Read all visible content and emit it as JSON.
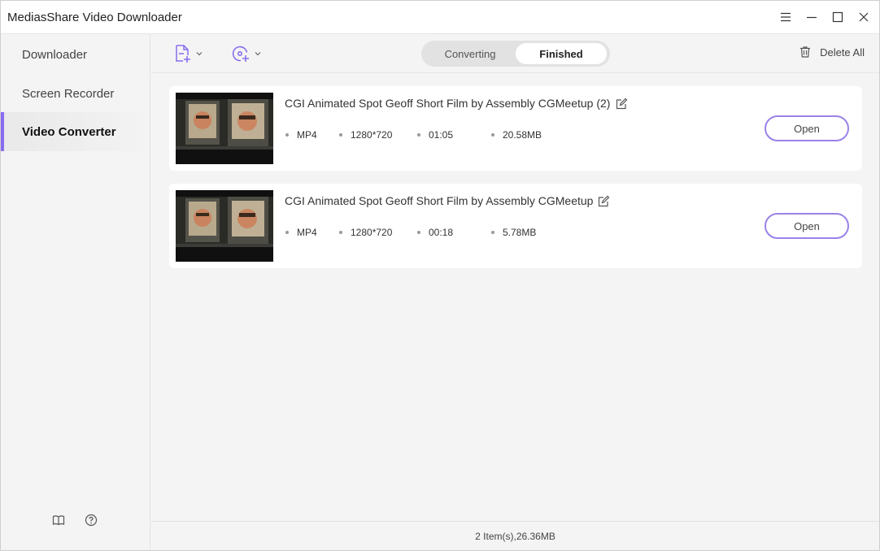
{
  "window": {
    "title": "MediasShare Video Downloader",
    "controls": [
      "menu-icon",
      "minimize-icon",
      "maximize-icon",
      "close-icon"
    ]
  },
  "sidebar": {
    "items": [
      {
        "label": "Downloader",
        "active": false
      },
      {
        "label": "Screen Recorder",
        "active": false
      },
      {
        "label": "Video Converter",
        "active": true
      }
    ],
    "bottom_icons": [
      "book-icon",
      "help-icon"
    ]
  },
  "toolbar": {
    "add_file_icon": "add-file-icon",
    "add_disc_icon": "add-disc-icon",
    "tabs": [
      {
        "label": "Converting",
        "active": false
      },
      {
        "label": "Finished",
        "active": true
      }
    ],
    "delete_all_label": "Delete All"
  },
  "items": [
    {
      "title": "CGI Animated Spot Geoff Short Film by Assembly  CGMeetup (2)",
      "format": "MP4",
      "resolution": "1280*720",
      "duration": "01:05",
      "size": "20.58MB",
      "open_label": "Open"
    },
    {
      "title": "CGI Animated Spot Geoff Short Film by Assembly  CGMeetup",
      "format": "MP4",
      "resolution": "1280*720",
      "duration": "00:18",
      "size": "5.78MB",
      "open_label": "Open"
    }
  ],
  "status": {
    "summary": "2 Item(s),26.36MB"
  },
  "colors": {
    "accent": "#8a6cf0",
    "button_border": "#9a82e8",
    "background": "#f4f4f4"
  }
}
